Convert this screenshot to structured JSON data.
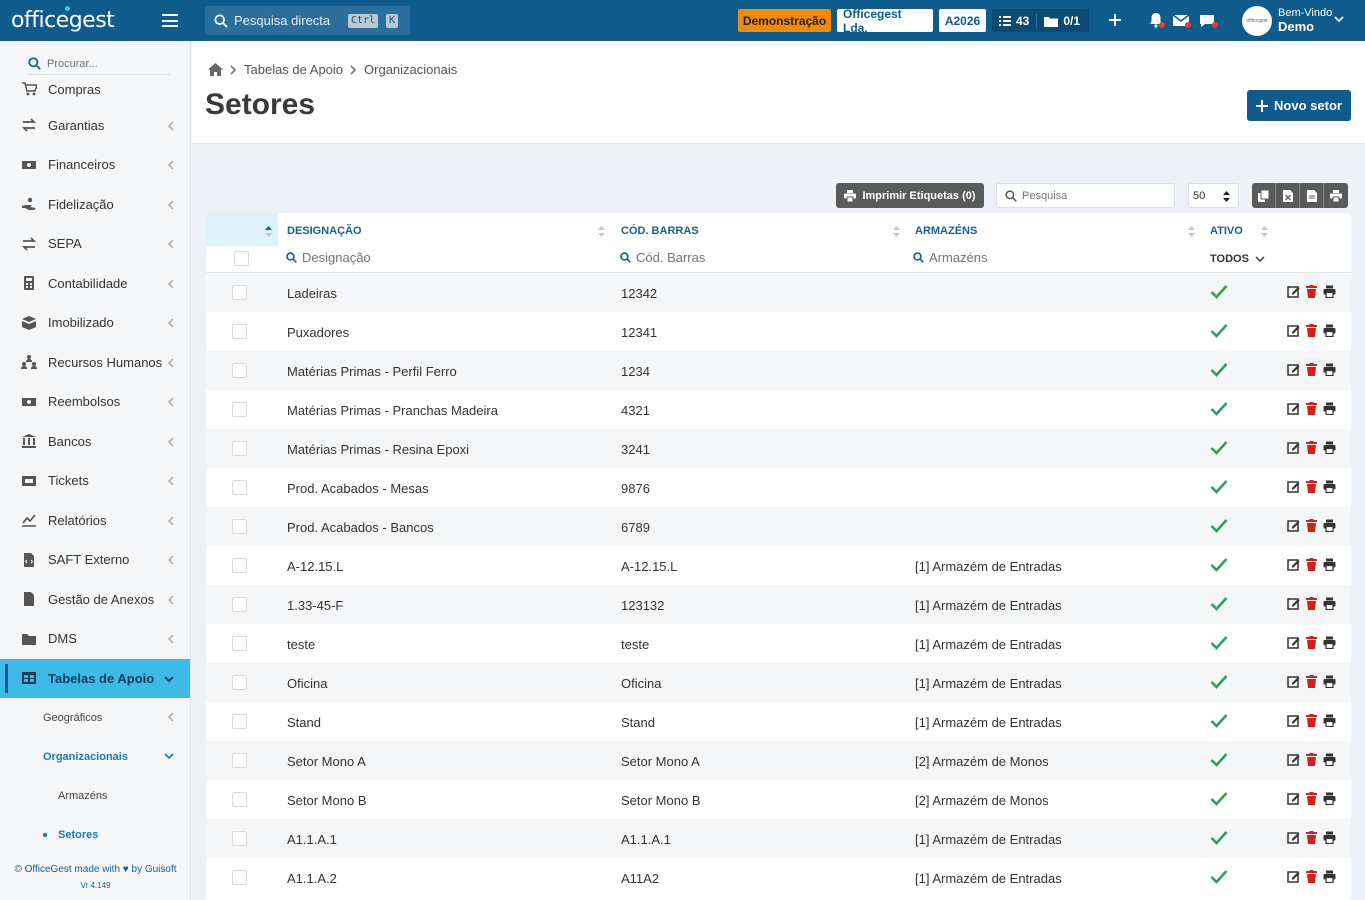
{
  "topbar": {
    "logo": "officegest",
    "search_placeholder": "Pesquisa directa",
    "kbd_ctrl": "Ctrl",
    "kbd_k": "K",
    "demo": "Demonstração",
    "company": "Officegest Lda.",
    "year": "A2026",
    "tasks_count": "43",
    "folders_count": "0/1",
    "welcome": "Bem-Vindo",
    "user": "Demo"
  },
  "sidebar": {
    "search_placeholder": "Procurar...",
    "items": [
      {
        "label": "Compras",
        "icon": "cart-icon"
      },
      {
        "label": "Garantias",
        "icon": "exchange-icon"
      },
      {
        "label": "Financeiros",
        "icon": "money-icon"
      },
      {
        "label": "Fidelização",
        "icon": "hand-icon"
      },
      {
        "label": "SEPA",
        "icon": "exchange-icon"
      },
      {
        "label": "Contabilidade",
        "icon": "calculator-icon"
      },
      {
        "label": "Imobilizado",
        "icon": "boxes-icon"
      },
      {
        "label": "Recursos Humanos",
        "icon": "people-icon"
      },
      {
        "label": "Reembolsos",
        "icon": "money-icon"
      },
      {
        "label": "Bancos",
        "icon": "bank-icon"
      },
      {
        "label": "Tickets",
        "icon": "ticket-icon"
      },
      {
        "label": "Relatórios",
        "icon": "chart-icon"
      },
      {
        "label": "SAFT Externo",
        "icon": "file-code-icon"
      },
      {
        "label": "Gestão de Anexos",
        "icon": "file-icon"
      },
      {
        "label": "DMS",
        "icon": "folder-icon"
      },
      {
        "label": "Tabelas de Apoio",
        "icon": "table-icon"
      }
    ],
    "sub": {
      "geograficos": "Geográficos",
      "organizacionais": "Organizacionais",
      "armazens": "Armazéns",
      "setores": "Setores"
    },
    "footer_line1": "© OfficeGest made with ♥ by Guisoft",
    "footer_version": "Vr 4.149"
  },
  "header": {
    "breadcrumb": [
      "Tabelas de Apoio",
      "Organizacionais"
    ],
    "title": "Setores",
    "new_button": "Novo setor"
  },
  "toolbar": {
    "print_labels": "Imprimir Etiquetas (0)",
    "search_placeholder": "Pesquisa",
    "per_page": "50"
  },
  "table": {
    "columns": {
      "designacao": "DESIGNAÇÃO",
      "cod_barras": "CÓD. BARRAS",
      "armazens": "ARMAZÉNS",
      "ativo": "ATIVO"
    },
    "filters": {
      "designacao": "Designação",
      "cod_barras": "Cód. Barras",
      "armazens": "Armazéns",
      "ativo": "TODOS"
    },
    "rows": [
      {
        "designacao": "Ladeiras",
        "cod_barras": "12342",
        "armazens": ""
      },
      {
        "designacao": "Puxadores",
        "cod_barras": "12341",
        "armazens": ""
      },
      {
        "designacao": "Matérias Primas - Perfil Ferro",
        "cod_barras": "1234",
        "armazens": ""
      },
      {
        "designacao": "Matérias Primas - Pranchas Madeira",
        "cod_barras": "4321",
        "armazens": ""
      },
      {
        "designacao": "Matérias Primas - Resina Epoxi",
        "cod_barras": "3241",
        "armazens": ""
      },
      {
        "designacao": "Prod. Acabados - Mesas",
        "cod_barras": "9876",
        "armazens": ""
      },
      {
        "designacao": "Prod. Acabados - Bancos",
        "cod_barras": "6789",
        "armazens": ""
      },
      {
        "designacao": "A-12.15.L",
        "cod_barras": "A-12.15.L",
        "armazens": "[1] Armazém de Entradas"
      },
      {
        "designacao": "1.33-45-F",
        "cod_barras": "123132",
        "armazens": "[1] Armazém de Entradas"
      },
      {
        "designacao": "teste",
        "cod_barras": "teste",
        "armazens": "[1] Armazém de Entradas"
      },
      {
        "designacao": "Oficina",
        "cod_barras": "Oficina",
        "armazens": "[1] Armazém de Entradas"
      },
      {
        "designacao": "Stand",
        "cod_barras": "Stand",
        "armazens": "[1] Armazém de Entradas"
      },
      {
        "designacao": "Setor Mono A",
        "cod_barras": "Setor Mono A",
        "armazens": "[2] Armazém de Monos"
      },
      {
        "designacao": "Setor Mono B",
        "cod_barras": "Setor Mono B",
        "armazens": "[2] Armazém de Monos"
      },
      {
        "designacao": "A1.1.A.1",
        "cod_barras": "A1.1.A.1",
        "armazens": "[1] Armazém de Entradas"
      },
      {
        "designacao": "A1.1.A.2",
        "cod_barras": "A11A2",
        "armazens": "[1] Armazém de Entradas"
      }
    ]
  },
  "colors": {
    "primary": "#0f5b8c",
    "accent": "#3fb9e8",
    "demo_badge": "#f08a0a",
    "check": "#2e9e5b",
    "delete": "#d0211c"
  }
}
